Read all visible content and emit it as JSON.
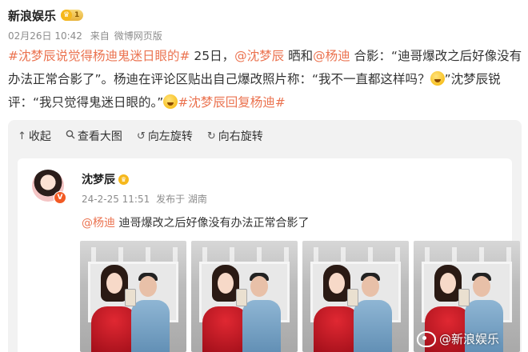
{
  "post": {
    "author": "新浪娱乐",
    "badge": "1",
    "date": "02月26日 10:42",
    "source_prefix": "来自",
    "source": "微博网页版",
    "topic1": "#沈梦辰说觉得杨迪鬼迷日眼的#",
    "t1": " 25日，",
    "mention1": "@沈梦辰",
    "t2": " 晒和",
    "mention2": "@杨迪",
    "t3": " 合影：“迪哥爆改之后好像没有办法正常合影了”。杨迪在评论区贴出自己爆改照片称：“我不一直都这样吗？",
    "t4": "”沈梦辰锐评：“我只觉得鬼迷日眼的。”",
    "topic2": "#沈梦辰回复杨迪#"
  },
  "toolbar": {
    "collapse": "收起",
    "view_large": "查看大图",
    "rotate_left": "向左旋转",
    "rotate_right": "向右旋转"
  },
  "repost": {
    "name": "沈梦辰",
    "date": "24-2-25 11:51",
    "location": "发布于 湖南",
    "mention": "@杨迪",
    "text": " 迪哥爆改之后好像没有办法正常合影了"
  },
  "watermark": "@新浪娱乐",
  "colors": {
    "link": "#eb7350",
    "badge": "#f6b81c",
    "dress": "#d0202b"
  },
  "icons": {
    "collapse": "arrow-up-icon",
    "view_large": "search-icon",
    "rotate_left": "rotate-left-icon",
    "rotate_right": "rotate-right-icon"
  }
}
